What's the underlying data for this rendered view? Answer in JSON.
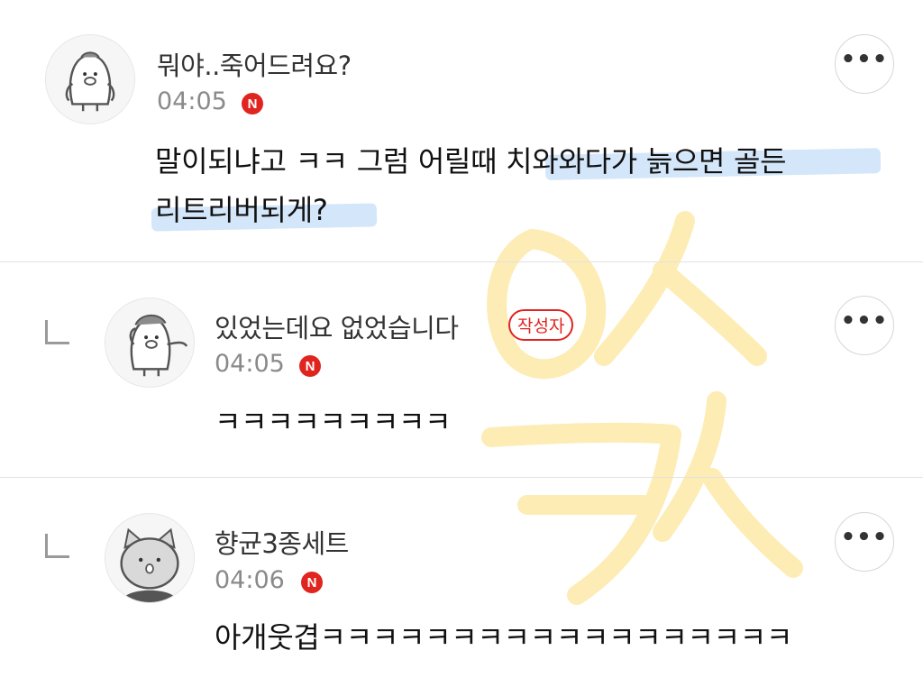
{
  "comments": [
    {
      "nickname": "뭐야..죽어드려요?",
      "time": "04:05",
      "badge": "N",
      "text_lines": [
        "말이되냐고 ㅋㅋ 그럼 어릴때 치와와다가 늙으면 골든",
        "리트리버되게?"
      ],
      "avatar_icon": "penguin-icon"
    },
    {
      "nickname": "있었는데요 없었습니다",
      "author_badge": "작성자",
      "time": "04:05",
      "badge": "N",
      "text_lines": [
        "ㅋㅋㅋㅋㅋㅋㅋㅋㅋ"
      ],
      "avatar_icon": "penguin-wave-icon"
    },
    {
      "nickname": "향균3종세트",
      "time": "04:06",
      "badge": "N",
      "text_lines": [
        "아개웃겹ㅋㅋㅋㅋㅋㅋㅋㅋㅋㅋㅋㅋㅋㅋㅋㅋㅋㅋ"
      ],
      "avatar_icon": "cat-icon"
    }
  ],
  "more_button_label": "•••",
  "colors": {
    "new_badge": "#e0241f",
    "author_badge": "#e0241f",
    "highlight": "#a0c8f5",
    "watermark": "#fde9a8"
  }
}
